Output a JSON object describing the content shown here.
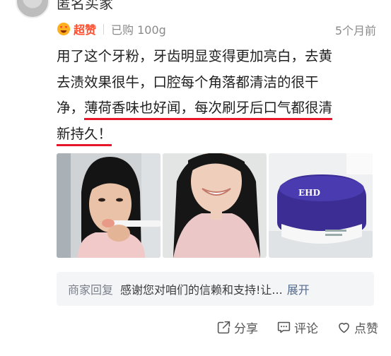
{
  "user": {
    "name": "匿名买家"
  },
  "meta": {
    "badge_label": "超赞",
    "purchase_info": "已购 100g",
    "time": "5个月前"
  },
  "review": {
    "lines": [
      "用了这个牙粉，牙齿明显变得更加亮白，去黄",
      "去渍效果很牛，口腔每个角落都清洁的很干",
      "净，",
      "薄荷香味也好闻，每次刷牙后口气都很清",
      "新持久！"
    ]
  },
  "photos": [
    {
      "icon": "photo-woman-brushing"
    },
    {
      "icon": "photo-woman-smiling"
    },
    {
      "icon": "photo-product-jar",
      "brand_text": "EHD"
    }
  ],
  "merchant_reply": {
    "label": "商家回复",
    "text": "感谢您对咱们的信赖和支持!让...",
    "expand": "展开"
  },
  "actions": {
    "share": "分享",
    "comment": "评论",
    "like": "点赞"
  },
  "colors": {
    "badge": "#ff4d2e",
    "highlight_underline": "#e8162a",
    "expand_link": "#556b8d"
  }
}
